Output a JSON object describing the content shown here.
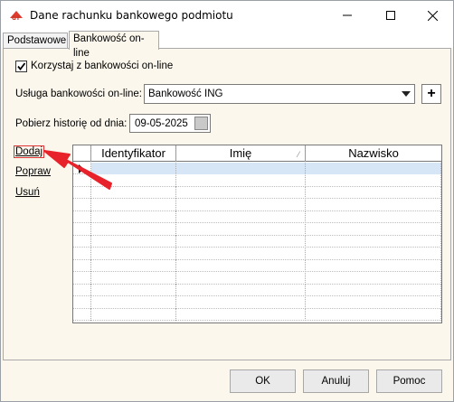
{
  "window": {
    "title": "Dane rachunku bankowego podmiotu"
  },
  "tabs": [
    {
      "label": "Podstawowe",
      "active": false
    },
    {
      "label": "Bankowość on-line",
      "active": true
    }
  ],
  "form": {
    "use_online_label": "Korzystaj z bankowości on-line",
    "use_online_checked": true,
    "service_label": "Usługa bankowości on-line:",
    "service_value": "Bankowość ING",
    "history_label": "Pobierz historię od dnia:",
    "history_date": "09-05-2025"
  },
  "actions": {
    "add": "Dodaj",
    "edit": "Popraw",
    "delete": "Usuń"
  },
  "grid": {
    "columns": [
      "Identyfikator",
      "Imię",
      "Nazwisko"
    ],
    "empty_rows": 13
  },
  "buttons": {
    "ok": "OK",
    "cancel": "Anuluj",
    "help": "Pomoc"
  },
  "colors": {
    "annotation_arrow": "#e8222a",
    "selected_row": "#d7e6f6"
  }
}
